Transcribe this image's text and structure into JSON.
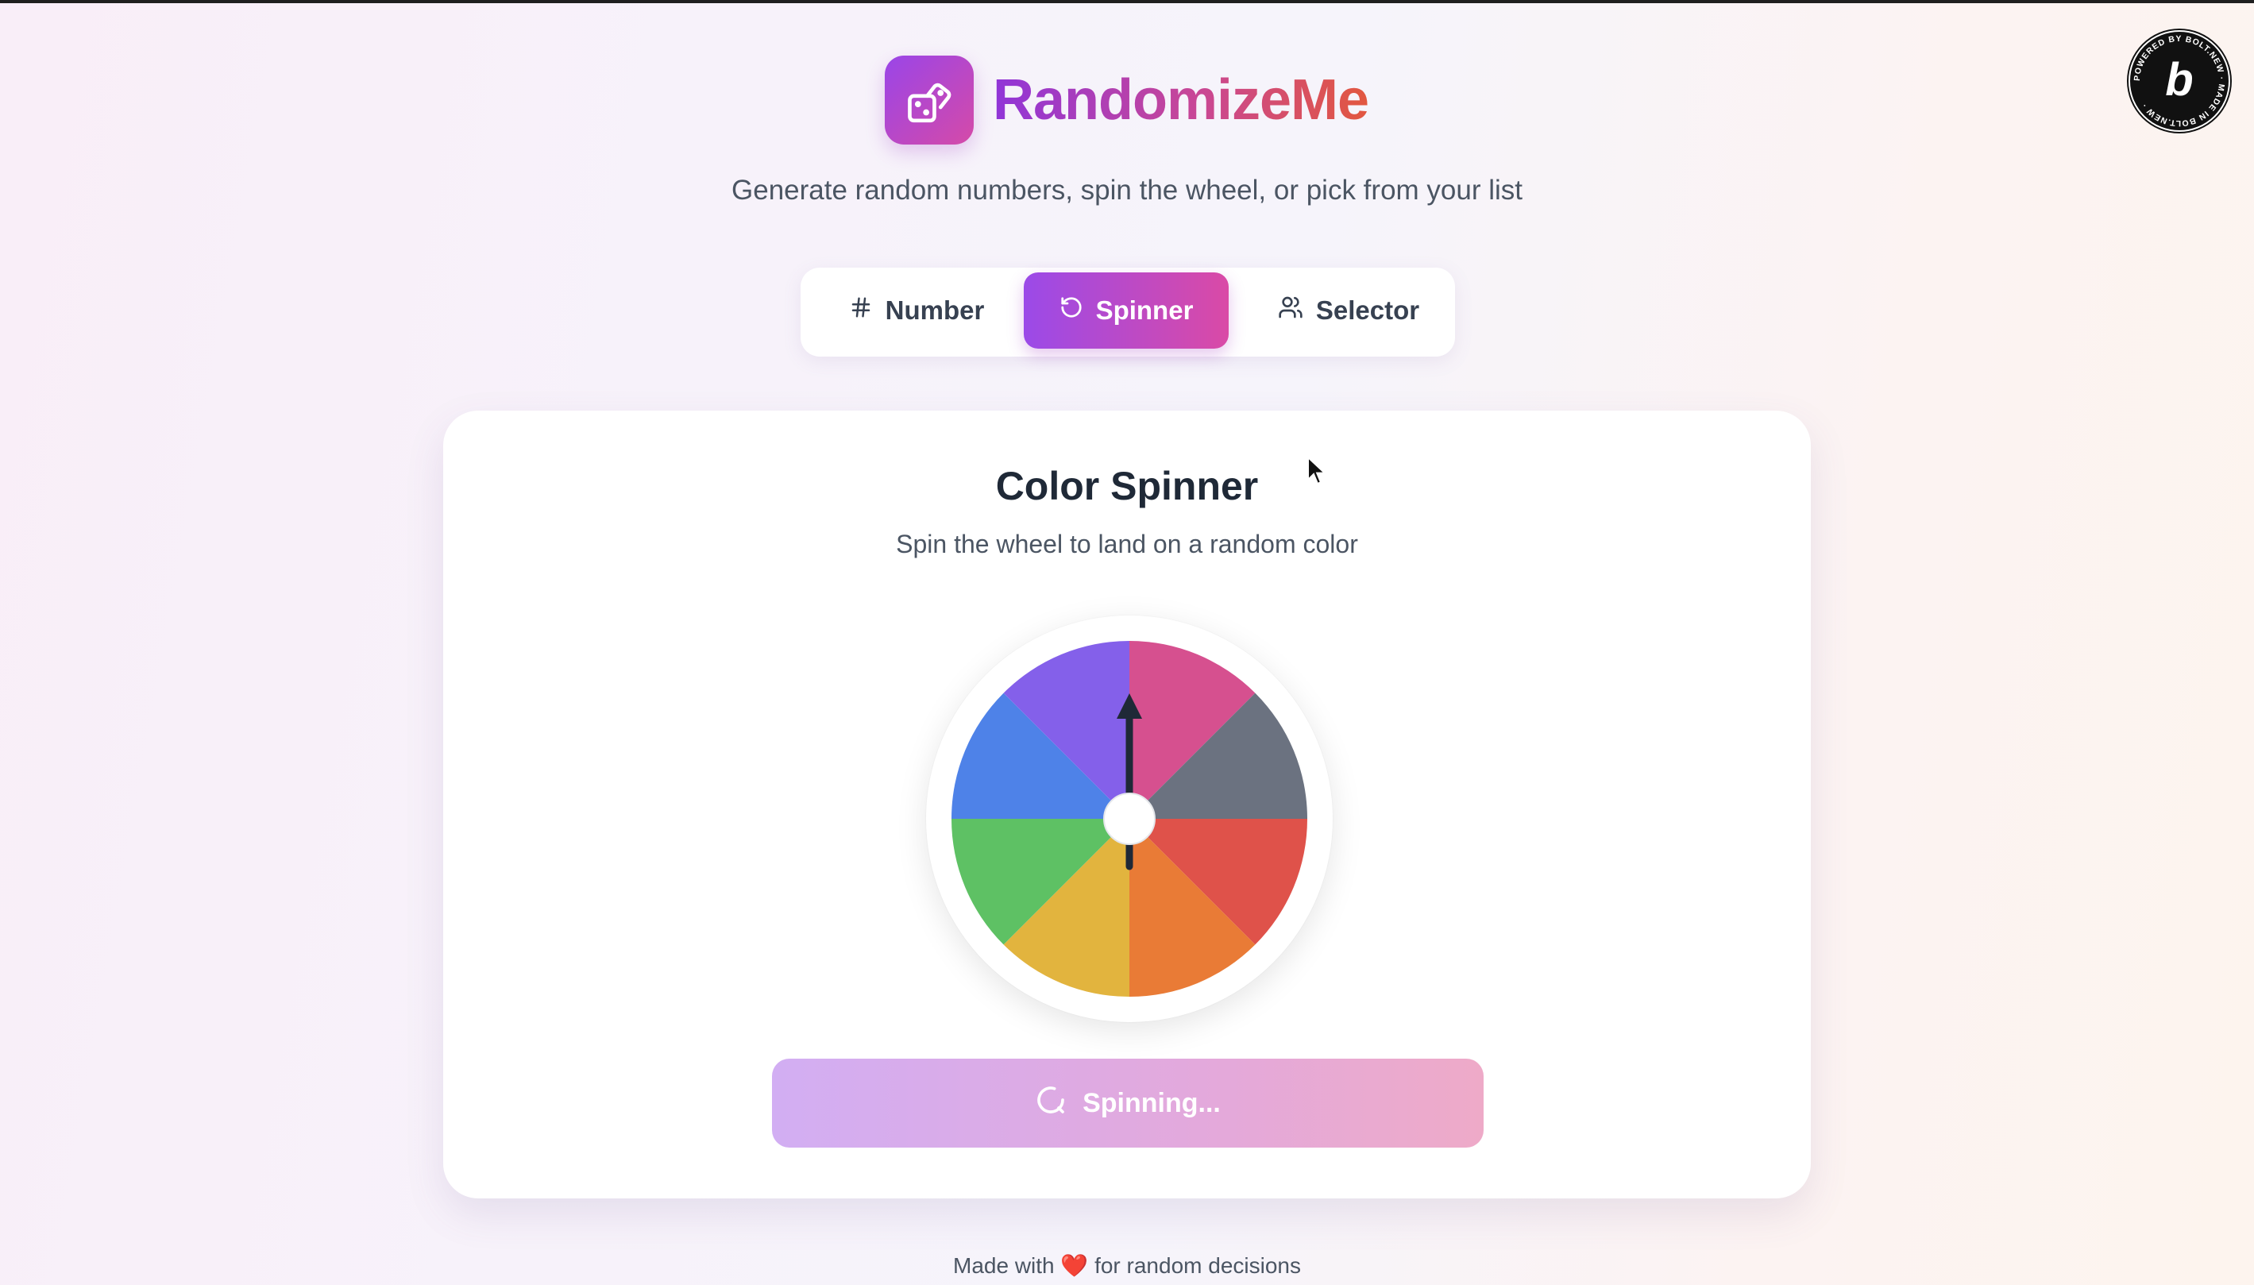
{
  "app": {
    "title": "RandomizeMe",
    "subtitle": "Generate random numbers, spin the wheel, or pick from your list",
    "logo_icon": "dice-icon"
  },
  "tabs": [
    {
      "label": "Number",
      "icon": "hash-icon",
      "active": false
    },
    {
      "label": "Spinner",
      "icon": "rotate-icon",
      "active": true
    },
    {
      "label": "Selector",
      "icon": "users-icon",
      "active": false
    }
  ],
  "spinner": {
    "title": "Color Spinner",
    "description": "Spin the wheel to land on a random color",
    "segments": [
      {
        "color": "#d6508f"
      },
      {
        "color": "#6b7280"
      },
      {
        "color": "#df524a"
      },
      {
        "color": "#e97b36"
      },
      {
        "color": "#e2b43e"
      },
      {
        "color": "#5ec164"
      },
      {
        "color": "#4e82e8"
      },
      {
        "color": "#8460ea"
      }
    ],
    "pointer_color": "#1f2937",
    "button_label": "Spinning...",
    "button_state": "disabled-spinning"
  },
  "footer": {
    "prefix": "Made with",
    "heart": "❤️",
    "suffix": "for random decisions"
  },
  "badge": {
    "ring_text": "POWERED BY BOLT.NEW · MADE IN BOLT.NEW ·",
    "letter": "b"
  },
  "colors": {
    "accent_start": "#9b4ae8",
    "accent_end": "#da4aa6",
    "brand_orange": "#e2573f"
  }
}
